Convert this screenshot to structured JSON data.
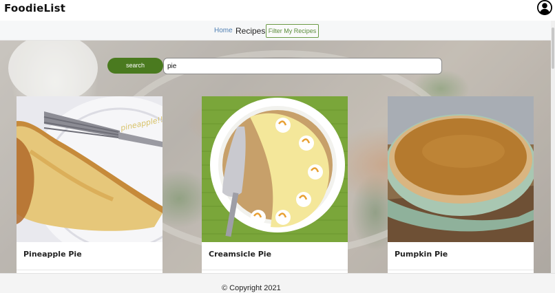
{
  "app": {
    "brand": "FoodieList"
  },
  "nav": {
    "home": "Home",
    "recipes": "Recipes",
    "filter": "Filter My Recipes"
  },
  "search": {
    "button_label": "search",
    "value": "pie"
  },
  "recipes": [
    {
      "title": "Pineapple Pie",
      "image_label": "pineapple!!"
    },
    {
      "title": "Creamsicle Pie"
    },
    {
      "title": "Pumpkin Pie"
    }
  ],
  "footer": {
    "copyright": "© Copyright 2021"
  },
  "colors": {
    "accent_green": "#4a7a1f",
    "link_blue": "#4f7fb3",
    "filter_green": "#5a8c3a"
  },
  "icons": {
    "profile": "user-circle-icon"
  }
}
